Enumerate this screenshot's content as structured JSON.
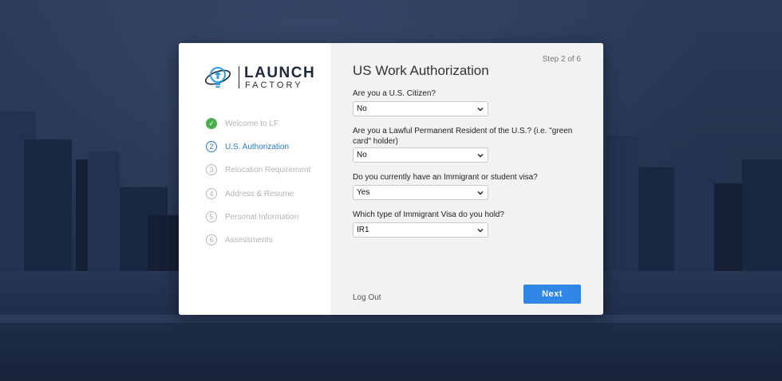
{
  "logo": {
    "word1": "LAUNCH",
    "word2": "FACTORY"
  },
  "steps": [
    {
      "num": "✓",
      "label": "Welcome to LF",
      "state": "done"
    },
    {
      "num": "2",
      "label": "U.S. Authorization",
      "state": "active"
    },
    {
      "num": "3",
      "label": "Relocation Requirement",
      "state": "pending"
    },
    {
      "num": "4",
      "label": "Address & Resume",
      "state": "pending"
    },
    {
      "num": "5",
      "label": "Personal Information",
      "state": "pending"
    },
    {
      "num": "6",
      "label": "Assessments",
      "state": "pending"
    }
  ],
  "form": {
    "step_indicator": "Step 2 of 6",
    "title": "US Work Authorization",
    "questions": [
      {
        "label": "Are you a U.S. Citizen?",
        "value": "No"
      },
      {
        "label": "Are you a Lawful Permanent Resident of the U.S.? (i.e. \"green card\" holder)",
        "value": "No"
      },
      {
        "label": "Do you currently have an Immigrant or student visa?",
        "value": "Yes"
      },
      {
        "label": "Which type of Immigrant Visa do you hold?",
        "value": "IR1"
      }
    ],
    "logout_label": "Log Out",
    "next_label": "Next"
  },
  "colors": {
    "accent": "#2f86e4",
    "active_step": "#2a7ad2",
    "done": "#4cae4f"
  }
}
